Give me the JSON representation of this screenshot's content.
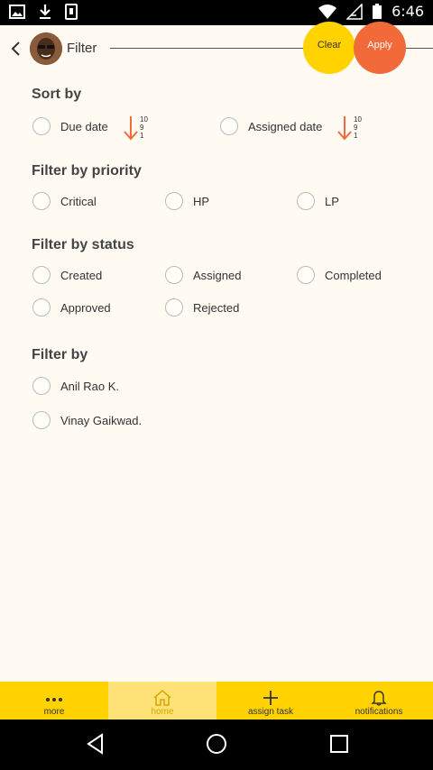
{
  "status_bar": {
    "time": "6:46",
    "left_icons": [
      "image-icon",
      "download-icon",
      "phone-icon"
    ],
    "right_icons": [
      "wifi-icon",
      "signal-icon",
      "battery-icon"
    ]
  },
  "header": {
    "title": "Filter",
    "clear_label": "Clear",
    "apply_label": "Apply"
  },
  "sort": {
    "title": "Sort by",
    "options": [
      {
        "label": "Due date",
        "nums": [
          "10",
          "9",
          "1"
        ]
      },
      {
        "label": "Assigned date",
        "nums": [
          "10",
          "9",
          "1"
        ]
      }
    ]
  },
  "priority": {
    "title": "Filter by priority",
    "options": [
      "Critical",
      "HP",
      "LP"
    ]
  },
  "status": {
    "title": "Filter by status",
    "options": [
      "Created",
      "Assigned",
      "Completed",
      "Approved",
      "Rejected"
    ]
  },
  "filter_by": {
    "title": "Filter by",
    "options": [
      "Anil Rao K.",
      "Vinay Gaikwad."
    ]
  },
  "bottom_nav": {
    "items": [
      {
        "label": "more",
        "icon": "more-icon"
      },
      {
        "label": "home",
        "icon": "home-icon"
      },
      {
        "label": "assign task",
        "icon": "plus-icon"
      },
      {
        "label": "notifications",
        "icon": "bell-icon"
      }
    ]
  },
  "colors": {
    "yellow": "#ffd200",
    "orange": "#f26a3a",
    "background": "#fffaf2",
    "home_active": "#d8a400"
  }
}
